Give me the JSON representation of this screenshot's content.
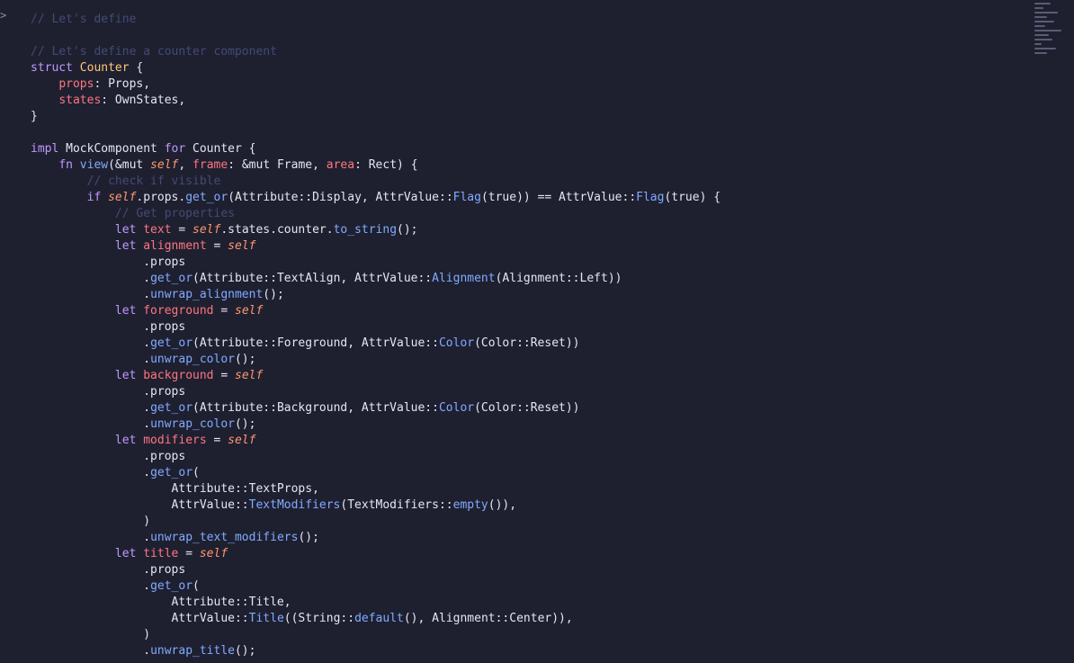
{
  "editor": {
    "language": "rust",
    "fold_marker": ">"
  },
  "theme": {
    "background": "#1e2030",
    "keyword": "#c099ff",
    "type": "#ffc777",
    "function": "#82aaff",
    "variable": "#ff757f",
    "self": "#ff966c",
    "operator": "#86e1fc",
    "comment": "#444a73",
    "text": "#e4e6f0"
  },
  "code_lines": [
    [
      [
        "cm",
        "// Let's define"
      ]
    ],
    [
      [
        "tx",
        ""
      ]
    ],
    [
      [
        "cm",
        "// Let's define a counter component"
      ]
    ],
    [
      [
        "kw",
        "struct"
      ],
      [
        "tx",
        " "
      ],
      [
        "ty",
        "Counter"
      ],
      [
        "tx",
        " {"
      ]
    ],
    [
      [
        "tx",
        "    "
      ],
      [
        "var",
        "props"
      ],
      [
        "tx",
        ": Props,"
      ]
    ],
    [
      [
        "tx",
        "    "
      ],
      [
        "var",
        "states"
      ],
      [
        "tx",
        ": OwnStates,"
      ]
    ],
    [
      [
        "tx",
        "}"
      ]
    ],
    [
      [
        "tx",
        ""
      ]
    ],
    [
      [
        "kw",
        "impl"
      ],
      [
        "tx",
        " MockComponent "
      ],
      [
        "kw",
        "for"
      ],
      [
        "tx",
        " Counter {"
      ]
    ],
    [
      [
        "tx",
        "    "
      ],
      [
        "kw",
        "fn"
      ],
      [
        "tx",
        " "
      ],
      [
        "fn",
        "view"
      ],
      [
        "tx",
        "(&mut "
      ],
      [
        "self",
        "self"
      ],
      [
        "tx",
        ", "
      ],
      [
        "var",
        "frame"
      ],
      [
        "tx",
        ": &mut Frame, "
      ],
      [
        "var",
        "area"
      ],
      [
        "tx",
        ": Rect) {"
      ]
    ],
    [
      [
        "cm",
        "        // check if visible"
      ]
    ],
    [
      [
        "tx",
        "        "
      ],
      [
        "kw",
        "if"
      ],
      [
        "tx",
        " "
      ],
      [
        "self",
        "self"
      ],
      [
        "tx",
        ".props."
      ],
      [
        "fn",
        "get_or"
      ],
      [
        "tx",
        "(Attribute::Display, AttrValue::"
      ],
      [
        "fn",
        "Flag"
      ],
      [
        "tx",
        "(true)) == AttrValue::"
      ],
      [
        "fn",
        "Flag"
      ],
      [
        "tx",
        "(true) {"
      ]
    ],
    [
      [
        "cm",
        "            // Get properties"
      ]
    ],
    [
      [
        "tx",
        "            "
      ],
      [
        "kw",
        "let"
      ],
      [
        "tx",
        " "
      ],
      [
        "var",
        "text"
      ],
      [
        "tx",
        " = "
      ],
      [
        "self",
        "self"
      ],
      [
        "tx",
        ".states.counter."
      ],
      [
        "fn",
        "to_string"
      ],
      [
        "tx",
        "();"
      ]
    ],
    [
      [
        "tx",
        "            "
      ],
      [
        "kw",
        "let"
      ],
      [
        "tx",
        " "
      ],
      [
        "var",
        "alignment"
      ],
      [
        "tx",
        " = "
      ],
      [
        "self",
        "self"
      ]
    ],
    [
      [
        "tx",
        "                .props"
      ]
    ],
    [
      [
        "tx",
        "                ."
      ],
      [
        "fn",
        "get_or"
      ],
      [
        "tx",
        "(Attribute::TextAlign, AttrValue::"
      ],
      [
        "fn",
        "Alignment"
      ],
      [
        "tx",
        "(Alignment::Left))"
      ]
    ],
    [
      [
        "tx",
        "                ."
      ],
      [
        "fn",
        "unwrap_alignment"
      ],
      [
        "tx",
        "();"
      ]
    ],
    [
      [
        "tx",
        "            "
      ],
      [
        "kw",
        "let"
      ],
      [
        "tx",
        " "
      ],
      [
        "var",
        "foreground"
      ],
      [
        "tx",
        " = "
      ],
      [
        "self",
        "self"
      ]
    ],
    [
      [
        "tx",
        "                .props"
      ]
    ],
    [
      [
        "tx",
        "                ."
      ],
      [
        "fn",
        "get_or"
      ],
      [
        "tx",
        "(Attribute::Foreground, AttrValue::"
      ],
      [
        "fn",
        "Color"
      ],
      [
        "tx",
        "(Color::Reset))"
      ]
    ],
    [
      [
        "tx",
        "                ."
      ],
      [
        "fn",
        "unwrap_color"
      ],
      [
        "tx",
        "();"
      ]
    ],
    [
      [
        "tx",
        "            "
      ],
      [
        "kw",
        "let"
      ],
      [
        "tx",
        " "
      ],
      [
        "var",
        "background"
      ],
      [
        "tx",
        " = "
      ],
      [
        "self",
        "self"
      ]
    ],
    [
      [
        "tx",
        "                .props"
      ]
    ],
    [
      [
        "tx",
        "                ."
      ],
      [
        "fn",
        "get_or"
      ],
      [
        "tx",
        "(Attribute::Background, AttrValue::"
      ],
      [
        "fn",
        "Color"
      ],
      [
        "tx",
        "(Color::Reset))"
      ]
    ],
    [
      [
        "tx",
        "                ."
      ],
      [
        "fn",
        "unwrap_color"
      ],
      [
        "tx",
        "();"
      ]
    ],
    [
      [
        "tx",
        "            "
      ],
      [
        "kw",
        "let"
      ],
      [
        "tx",
        " "
      ],
      [
        "var",
        "modifiers"
      ],
      [
        "tx",
        " = "
      ],
      [
        "self",
        "self"
      ]
    ],
    [
      [
        "tx",
        "                .props"
      ]
    ],
    [
      [
        "tx",
        "                ."
      ],
      [
        "fn",
        "get_or"
      ],
      [
        "tx",
        "("
      ]
    ],
    [
      [
        "tx",
        "                    Attribute::TextProps,"
      ]
    ],
    [
      [
        "tx",
        "                    AttrValue::"
      ],
      [
        "fn",
        "TextModifiers"
      ],
      [
        "tx",
        "(TextModifiers::"
      ],
      [
        "fn",
        "empty"
      ],
      [
        "tx",
        "()),"
      ]
    ],
    [
      [
        "tx",
        "                )"
      ]
    ],
    [
      [
        "tx",
        "                ."
      ],
      [
        "fn",
        "unwrap_text_modifiers"
      ],
      [
        "tx",
        "();"
      ]
    ],
    [
      [
        "tx",
        "            "
      ],
      [
        "kw",
        "let"
      ],
      [
        "tx",
        " "
      ],
      [
        "var",
        "title"
      ],
      [
        "tx",
        " = "
      ],
      [
        "self",
        "self"
      ]
    ],
    [
      [
        "tx",
        "                .props"
      ]
    ],
    [
      [
        "tx",
        "                ."
      ],
      [
        "fn",
        "get_or"
      ],
      [
        "tx",
        "("
      ]
    ],
    [
      [
        "tx",
        "                    Attribute::Title,"
      ]
    ],
    [
      [
        "tx",
        "                    AttrValue::"
      ],
      [
        "fn",
        "Title"
      ],
      [
        "tx",
        "((String::"
      ],
      [
        "fn",
        "default"
      ],
      [
        "tx",
        "(), Alignment::Center)),"
      ]
    ],
    [
      [
        "tx",
        "                )"
      ]
    ],
    [
      [
        "tx",
        "                ."
      ],
      [
        "fn",
        "unwrap_title"
      ],
      [
        "tx",
        "();"
      ]
    ]
  ]
}
